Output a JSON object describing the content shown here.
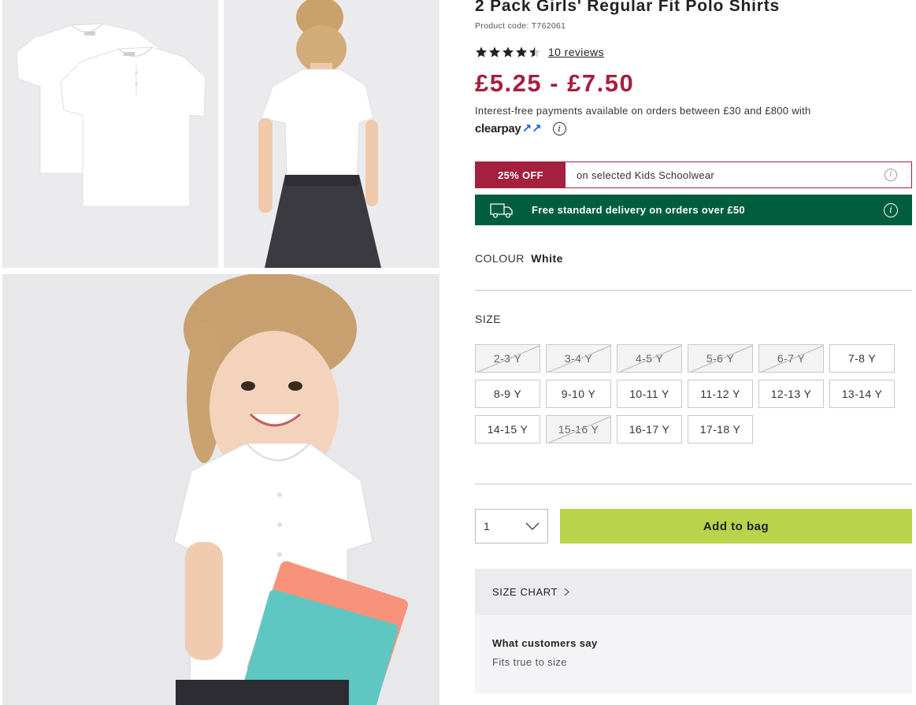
{
  "product": {
    "title": "2 Pack Girls' Regular Fit Polo Shirts",
    "product_code": "Product code: T762061",
    "rating": 4.5,
    "reviews_link": "10 reviews",
    "price": "£5.25 - £7.50"
  },
  "finance": {
    "text": "Interest-free payments available on orders between £30 and £800 with",
    "logo_text": "clearpay"
  },
  "offer": {
    "badge": "25% OFF",
    "text": "on selected Kids Schoolwear",
    "accent_color": "#a51f3e"
  },
  "delivery": {
    "text": "Free standard delivery on orders over £50",
    "background_color": "#005e3f"
  },
  "colour": {
    "label": "COLOUR",
    "value": "White"
  },
  "size": {
    "label": "SIZE",
    "options": [
      {
        "label": "2-3 Y",
        "available": false
      },
      {
        "label": "3-4 Y",
        "available": false
      },
      {
        "label": "4-5 Y",
        "available": false
      },
      {
        "label": "5-6 Y",
        "available": false
      },
      {
        "label": "6-7 Y",
        "available": false
      },
      {
        "label": "7-8 Y",
        "available": true
      },
      {
        "label": "8-9 Y",
        "available": true
      },
      {
        "label": "9-10 Y",
        "available": true
      },
      {
        "label": "10-11 Y",
        "available": true
      },
      {
        "label": "11-12 Y",
        "available": true
      },
      {
        "label": "12-13 Y",
        "available": true
      },
      {
        "label": "13-14 Y",
        "available": true
      },
      {
        "label": "14-15 Y",
        "available": true
      },
      {
        "label": "15-16 Y",
        "available": false
      },
      {
        "label": "16-17 Y",
        "available": true
      },
      {
        "label": "17-18 Y",
        "available": true
      }
    ]
  },
  "purchase": {
    "quantity": "1",
    "add_to_bag": "Add to bag",
    "button_color": "#b9d34b"
  },
  "size_chart": {
    "label": "SIZE CHART"
  },
  "customer_reviews": {
    "heading": "What customers say",
    "summary": "Fits true to size"
  },
  "icons": [
    "star-icon",
    "info-icon",
    "delivery-van-icon",
    "chevron-down-icon",
    "chevron-right-icon"
  ]
}
